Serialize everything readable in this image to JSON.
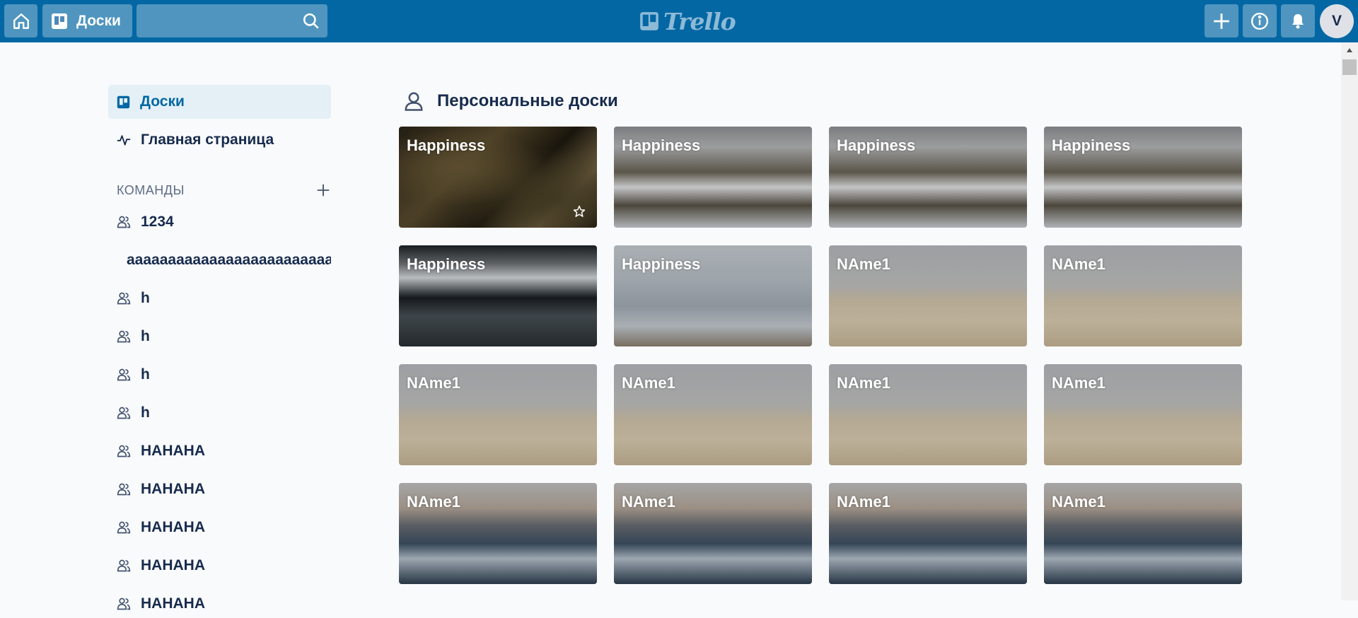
{
  "header": {
    "boards_label": "Доски",
    "search_placeholder": "",
    "logo_text": "Trello",
    "avatar_initial": "V"
  },
  "sidebar": {
    "nav": [
      {
        "label": "Доски",
        "icon": "board-icon",
        "active": true
      },
      {
        "label": "Главная страница",
        "icon": "activity-icon",
        "active": false
      }
    ],
    "teams_header": "КОМАНДЫ",
    "teams": [
      {
        "label": "1234"
      },
      {
        "label": "aaaaaaaaaaaaaaaaaaaaaaaaaaaaaaaaaaaaaa"
      },
      {
        "label": "h"
      },
      {
        "label": "h"
      },
      {
        "label": "h"
      },
      {
        "label": "h"
      },
      {
        "label": "HAHAHA"
      },
      {
        "label": "HAHAHA"
      },
      {
        "label": "HAHAHA"
      },
      {
        "label": "HAHAHA"
      },
      {
        "label": "HAHAHA"
      }
    ]
  },
  "main": {
    "section_title": "Персональные доски",
    "boards": [
      {
        "name": "Happiness",
        "bg": "palm"
      },
      {
        "name": "Happiness",
        "bg": "peaks"
      },
      {
        "name": "Happiness",
        "bg": "peaks"
      },
      {
        "name": "Happiness",
        "bg": "peaks"
      },
      {
        "name": "Happiness",
        "bg": "lake"
      },
      {
        "name": "Happiness",
        "bg": "valley"
      },
      {
        "name": "NAme1",
        "bg": "desert"
      },
      {
        "name": "NAme1",
        "bg": "desert"
      },
      {
        "name": "NAme1",
        "bg": "desert"
      },
      {
        "name": "NAme1",
        "bg": "desert"
      },
      {
        "name": "NAme1",
        "bg": "desert"
      },
      {
        "name": "NAme1",
        "bg": "desert"
      },
      {
        "name": "NAme1",
        "bg": "alpine"
      },
      {
        "name": "NAme1",
        "bg": "alpine"
      },
      {
        "name": "NAme1",
        "bg": "alpine"
      },
      {
        "name": "NAme1",
        "bg": "alpine"
      }
    ]
  },
  "colors": {
    "header_bg": "#0367a4",
    "active_nav_bg": "#e4f0f6",
    "active_nav_text": "#0067a3",
    "text": "#172b4d"
  }
}
